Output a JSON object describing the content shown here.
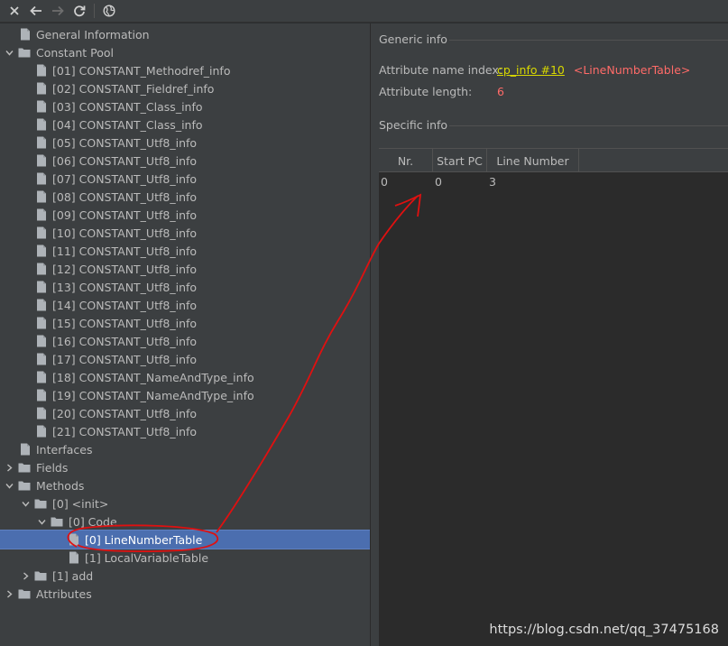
{
  "toolbar": {
    "buttons": [
      {
        "icon": "close-icon"
      },
      {
        "icon": "back-arrow-icon"
      },
      {
        "icon": "forward-arrow-icon"
      },
      {
        "icon": "refresh-icon"
      },
      {
        "icon": "globe-icon"
      }
    ]
  },
  "tree": {
    "general_information": "General Information",
    "constant_pool": "Constant Pool",
    "constants": [
      "[01] CONSTANT_Methodref_info",
      "[02] CONSTANT_Fieldref_info",
      "[03] CONSTANT_Class_info",
      "[04] CONSTANT_Class_info",
      "[05] CONSTANT_Utf8_info",
      "[06] CONSTANT_Utf8_info",
      "[07] CONSTANT_Utf8_info",
      "[08] CONSTANT_Utf8_info",
      "[09] CONSTANT_Utf8_info",
      "[10] CONSTANT_Utf8_info",
      "[11] CONSTANT_Utf8_info",
      "[12] CONSTANT_Utf8_info",
      "[13] CONSTANT_Utf8_info",
      "[14] CONSTANT_Utf8_info",
      "[15] CONSTANT_Utf8_info",
      "[16] CONSTANT_Utf8_info",
      "[17] CONSTANT_Utf8_info",
      "[18] CONSTANT_NameAndType_info",
      "[19] CONSTANT_NameAndType_info",
      "[20] CONSTANT_Utf8_info",
      "[21] CONSTANT_Utf8_info"
    ],
    "interfaces": "Interfaces",
    "fields": "Fields",
    "methods": "Methods",
    "method_init": "[0] <init>",
    "code": "[0] Code",
    "line_number_table": "[0] LineNumberTable",
    "local_variable_table": "[1] LocalVariableTable",
    "method_add": "[1] add",
    "attributes": "Attributes"
  },
  "panel": {
    "generic_info_title": "Generic info",
    "attr_name_index_label": "Attribute name index:",
    "attr_name_index_link": "cp_info #10",
    "attr_name_index_ref": "<LineNumberTable>",
    "attr_length_label": "Attribute length:",
    "attr_length_value": "6",
    "specific_info_title": "Specific info",
    "table": {
      "headers": [
        "Nr.",
        "Start PC",
        "Line Number"
      ],
      "rows": [
        [
          "0",
          "0",
          "3"
        ]
      ]
    }
  },
  "watermark": "https://blog.csdn.net/qq_37475168",
  "colors": {
    "selection": "#4b6eaf",
    "link": "#d8d800",
    "reference": "#ff6b68",
    "annotation": "#e01010"
  }
}
